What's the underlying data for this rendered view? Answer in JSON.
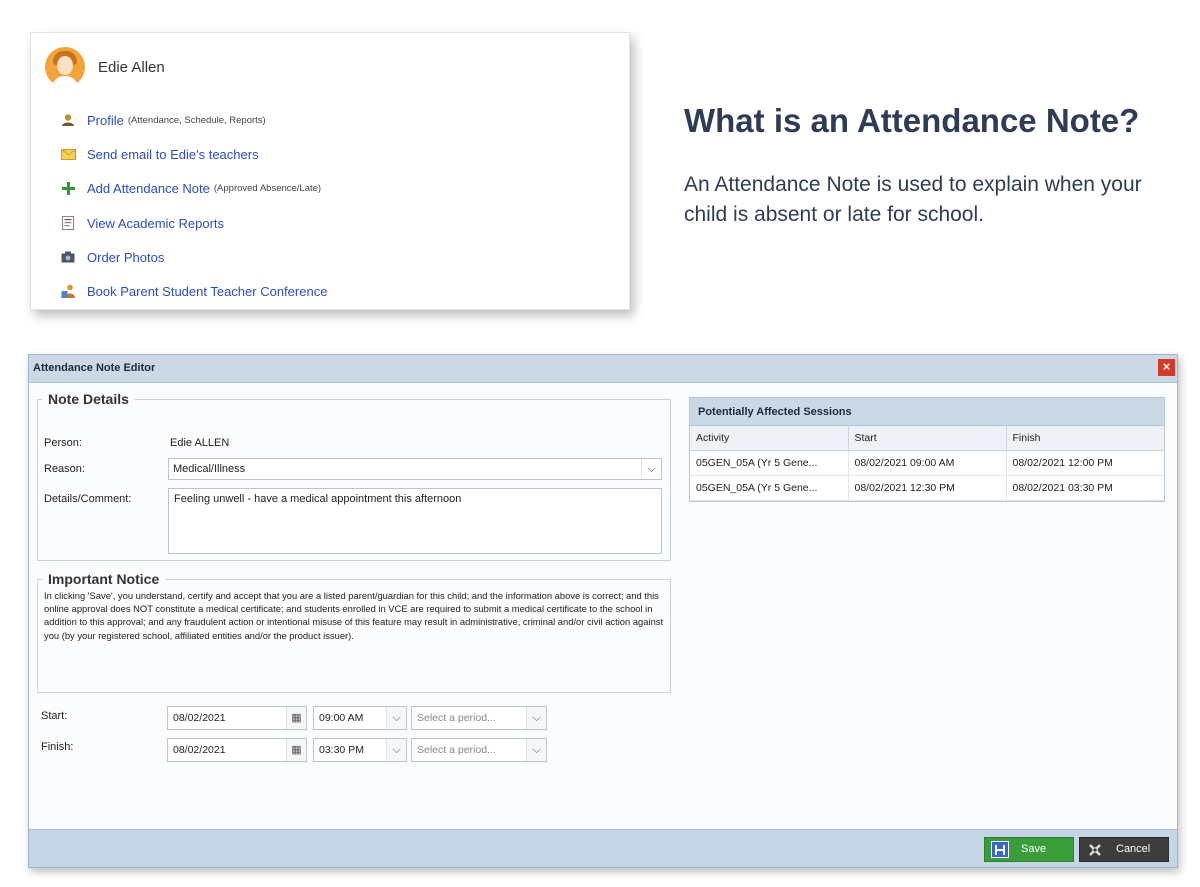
{
  "profile_card": {
    "name": "Edie Allen",
    "items": [
      {
        "icon": "person-icon",
        "label": "Profile",
        "note": "(Attendance, Schedule, Reports)"
      },
      {
        "icon": "envelope-icon",
        "label": "Send email to Edie's teachers",
        "note": ""
      },
      {
        "icon": "plus-icon",
        "label": "Add Attendance Note",
        "note": "(Approved Absence/Late)"
      },
      {
        "icon": "report-icon",
        "label": "View Academic Reports",
        "note": ""
      },
      {
        "icon": "camera-icon",
        "label": "Order Photos",
        "note": ""
      },
      {
        "icon": "conference-icon",
        "label": "Book Parent Student Teacher Conference",
        "note": ""
      }
    ]
  },
  "headline": "What is an Attendance Note?",
  "intro": "An Attendance Note is used to explain when your child is absent or late for school.",
  "dialog": {
    "title": "Attendance Note Editor",
    "close_glyph": "×",
    "note_details": {
      "legend": "Note Details",
      "person_label": "Person:",
      "person_value": "Edie ALLEN",
      "reason_label": "Reason:",
      "reason_value": "Medical/Illness",
      "comment_label": "Details/Comment:",
      "comment_value": "Feeling unwell - have a medical appointment this afternoon"
    },
    "notice": {
      "legend": "Important Notice",
      "text": "In clicking 'Save', you understand, certify and accept that you are a listed parent/guardian for this child; and the information above is correct; and this online approval does NOT constitute a medical certificate; and students enrolled in VCE are required to submit a medical certificate to the school in addition to this approval; and any fraudulent action or intentional misuse of this feature may result in administrative, criminal and/or civil action against you (by your registered school, affiliated entities and/or the product issuer)."
    },
    "start": {
      "label": "Start:",
      "date": "08/02/2021",
      "time": "09:00 AM",
      "period_placeholder": "Select a period..."
    },
    "finish": {
      "label": "Finish:",
      "date": "08/02/2021",
      "time": "03:30 PM",
      "period_placeholder": "Select a period..."
    },
    "sessions": {
      "title": "Potentially Affected Sessions",
      "columns": [
        "Activity",
        "Start",
        "Finish"
      ],
      "rows": [
        [
          "05GEN_05A (Yr 5 Gene...",
          "08/02/2021 09:00 AM",
          "08/02/2021 12:00 PM"
        ],
        [
          "05GEN_05A (Yr 5 Gene...",
          "08/02/2021 12:30 PM",
          "08/02/2021 03:30 PM"
        ]
      ]
    },
    "save_label": "Save",
    "cancel_label": "Cancel"
  }
}
